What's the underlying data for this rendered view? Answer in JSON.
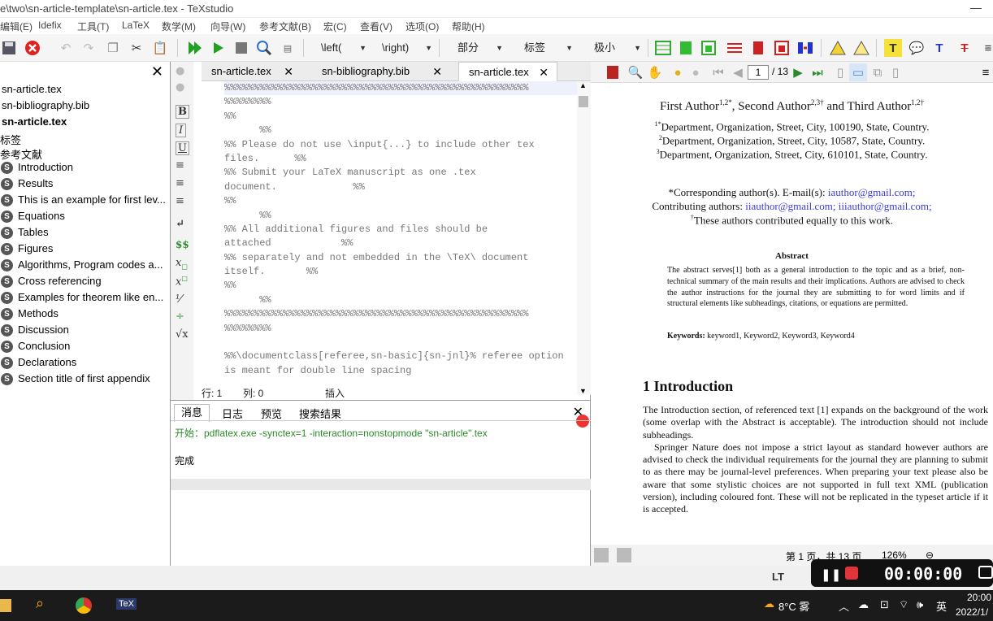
{
  "window": {
    "title": "e\\two\\sn-article-template\\sn-article.tex - TeXstudio",
    "minimize": "—"
  },
  "menu": [
    "编辑(E)",
    "Idefix",
    "工具(T)",
    "LaTeX",
    "数学(M)",
    "向导(W)",
    "参考文献(B)",
    "宏(C)",
    "查看(V)",
    "选项(O)",
    "帮助(H)"
  ],
  "toolbar": {
    "left_paren": "\\left(",
    "right_paren": "\\right)",
    "section": "部分",
    "label": "标签",
    "size": "极小"
  },
  "sidebar": {
    "close": "✕",
    "files": [
      "sn-article.tex",
      "sn-bibliography.bib",
      "sn-article.tex"
    ],
    "groups": [
      "标签",
      "参考文献"
    ],
    "sections": [
      "Introduction",
      "Results",
      "This is an example for first lev...",
      "Equations",
      "Tables",
      "Figures",
      "Algorithms, Program codes a...",
      "Cross referencing",
      "Examples for theorem like en...",
      "Methods",
      "Discussion",
      "Conclusion",
      "Declarations",
      "Section title of first appendix"
    ]
  },
  "tabs": [
    {
      "label": "sn-article.tex"
    },
    {
      "label": "sn-bibliography.bib"
    },
    {
      "label": "sn-article.tex"
    }
  ],
  "code_lines": [
    "%%%%%%%%%%%%%%%%%%%%%%%%%%%%%%%%%%%%%%%%%%%%%%%%%%%%",
    "%%%%%%%%",
    "%%",
    "      %%",
    "%% Please do not use \\input{...} to include other tex",
    "files.      %%",
    "%% Submit your LaTeX manuscript as one .tex",
    "document.             %%",
    "%%",
    "      %%",
    "%% All additional figures and files should be",
    "attached            %%",
    "%% separately and not embedded in the \\TeX\\ document",
    "itself.       %%",
    "%%",
    "      %%",
    "%%%%%%%%%%%%%%%%%%%%%%%%%%%%%%%%%%%%%%%%%%%%%%%%%%%%",
    "%%%%%%%%",
    "",
    "%%\\documentclass[referee,sn-basic]{sn-jnl}% referee option",
    "is meant for double line spacing"
  ],
  "editor_status": {
    "line_label": "行: 1",
    "col_label": "列: 0",
    "mode": "插入"
  },
  "messages": {
    "tabs": [
      "消息",
      "日志",
      "预览",
      "搜索结果"
    ],
    "command": "开始：pdflatex.exe -synctex=1 -interaction=nonstopmode \"sn-article\".tex",
    "done": "完成"
  },
  "viewer": {
    "page_input": "1",
    "page_total": "/ 13",
    "authors": "First Author",
    "authors_sup1": "1,2*",
    "authors_second": ", Second Author",
    "authors_sup2": "2,3†",
    "authors_third": " and Third Author",
    "authors_sup3": "1,2†",
    "affil1": "Department, Organization, Street, City, 100190, State, Country.",
    "affil1_sup": "1*",
    "affil2": "Department, Organization, Street, City, 10587, State, Country.",
    "affil2_sup": "2",
    "affil3": "Department, Organization, Street, City, 610101, State, Country.",
    "affil3_sup": "3",
    "corr_prefix": "*Corresponding author(s). E-mail(s): ",
    "corr_email": "iauthor@gmail.com;",
    "contrib_prefix": "Contributing authors: ",
    "contrib_email1": "iiauthor@gmail.com;",
    "contrib_email2": "iiiauthor@gmail.com;",
    "equal": "These authors contributed equally to this work.",
    "equal_sup": "†",
    "abstract_title": "Abstract",
    "abstract_text": "The abstract serves[1] both as a general introduction to the topic and as a brief, non-technical summary of the main results and their implications. Authors are advised to check the author instructions for the journal they are submitting to for word limits and if structural elements like subheadings, citations, or equations are permitted.",
    "keywords_label": "Keywords:",
    "keywords": "keyword1, Keyword2, Keyword3, Keyword4",
    "section_heading": "1  Introduction",
    "intro_p1": "The Introduction section, of referenced text [1] expands on the background of the work (some overlap with the Abstract is acceptable). The introduction should not include subheadings.",
    "intro_p2": "Springer Nature does not impose a strict layout as standard however authors are advised to check the individual requirements for the journal they are planning to submit to as there may be journal-level preferences. When preparing your text please also be aware that some stylistic choices are not supported in full text XML (publication version), including coloured font. These will not be replicated in the typeset article if it is accepted.",
    "status_page": "第 1 页，共 13 页",
    "zoom": "126%"
  },
  "recorder": {
    "time": "00:00:00"
  },
  "taskbar": {
    "weather": "8°C 雾",
    "ime": "英",
    "time": "20:00",
    "date": "2022/1/"
  },
  "colors": {
    "run_green": "#21a121",
    "stop_red": "#e0343a",
    "link_blue": "#3a3ad8",
    "log_green": "#2a8a2a"
  }
}
